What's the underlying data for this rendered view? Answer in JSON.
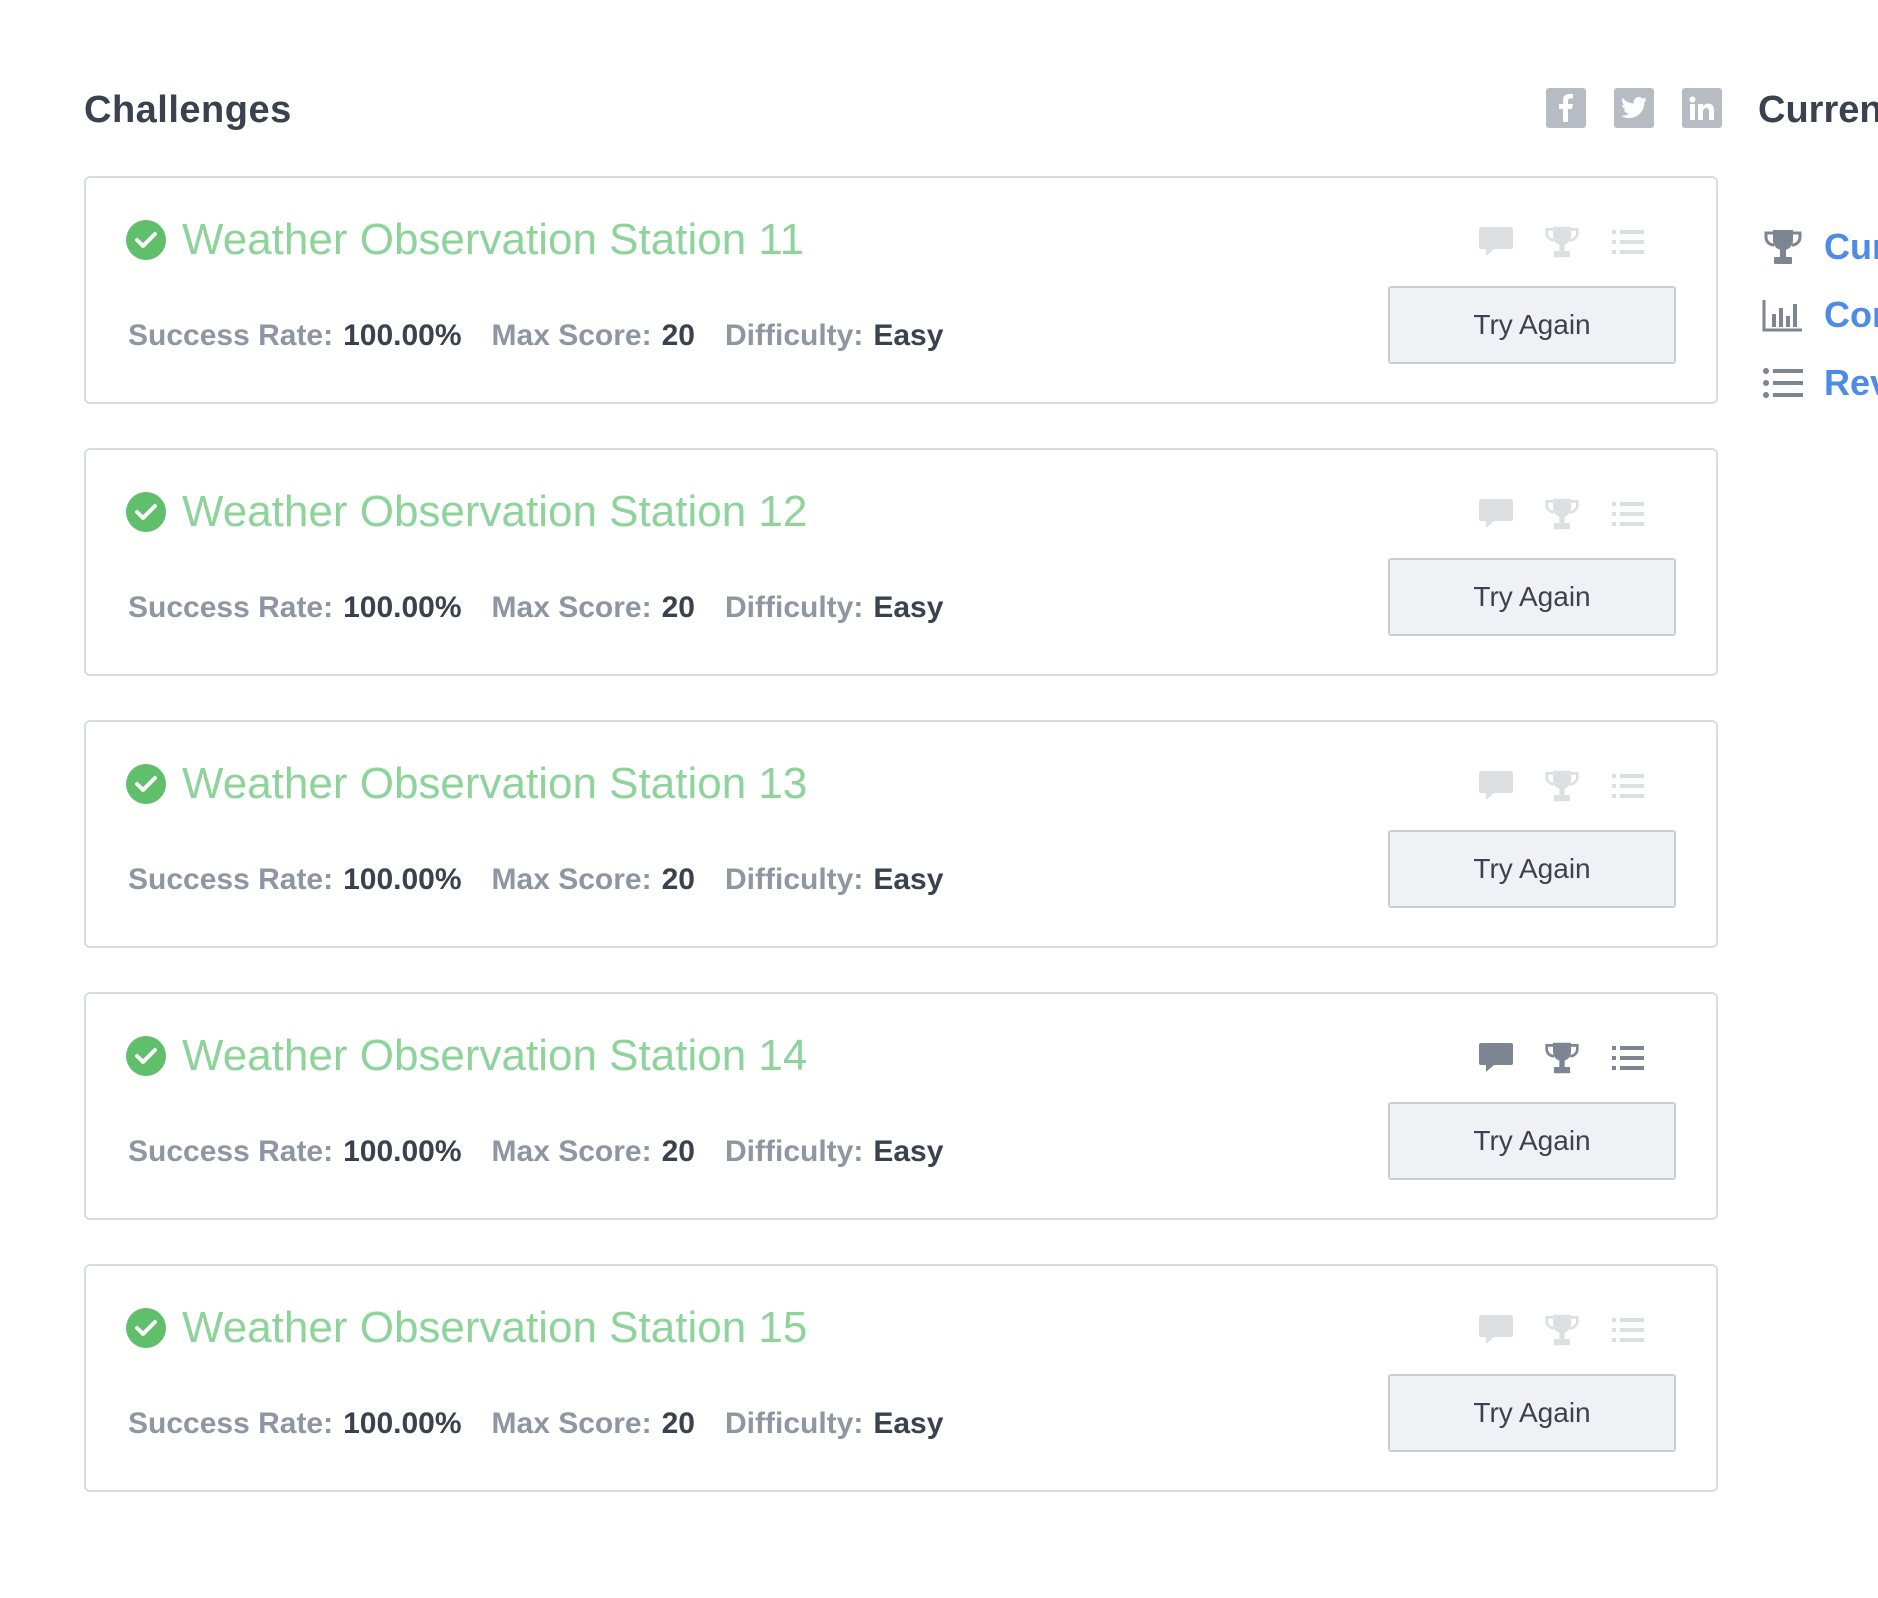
{
  "header": {
    "title": "Challenges",
    "share": [
      {
        "icon": "facebook-icon"
      },
      {
        "icon": "twitter-icon"
      },
      {
        "icon": "linkedin-icon"
      }
    ]
  },
  "challenges": [
    {
      "title": "Weather Observation Station 11",
      "success_rate_label": "Success Rate:",
      "success_rate": "100.00%",
      "max_score_label": "Max Score:",
      "max_score": "20",
      "difficulty_label": "Difficulty:",
      "difficulty": "Easy",
      "button": "Try Again",
      "icons_active": false
    },
    {
      "title": "Weather Observation Station 12",
      "success_rate_label": "Success Rate:",
      "success_rate": "100.00%",
      "max_score_label": "Max Score:",
      "max_score": "20",
      "difficulty_label": "Difficulty:",
      "difficulty": "Easy",
      "button": "Try Again",
      "icons_active": false
    },
    {
      "title": "Weather Observation Station 13",
      "success_rate_label": "Success Rate:",
      "success_rate": "100.00%",
      "max_score_label": "Max Score:",
      "max_score": "20",
      "difficulty_label": "Difficulty:",
      "difficulty": "Easy",
      "button": "Try Again",
      "icons_active": false
    },
    {
      "title": "Weather Observation Station 14",
      "success_rate_label": "Success Rate:",
      "success_rate": "100.00%",
      "max_score_label": "Max Score:",
      "max_score": "20",
      "difficulty_label": "Difficulty:",
      "difficulty": "Easy",
      "button": "Try Again",
      "icons_active": true
    },
    {
      "title": "Weather Observation Station 15",
      "success_rate_label": "Success Rate:",
      "success_rate": "100.00%",
      "max_score_label": "Max Score:",
      "max_score": "20",
      "difficulty_label": "Difficulty:",
      "difficulty": "Easy",
      "button": "Try Again",
      "icons_active": false
    }
  ],
  "sidebar": {
    "title": "Curren",
    "links": [
      {
        "label": "Cur",
        "icon": "trophy-icon"
      },
      {
        "label": "Con",
        "icon": "bar-chart-icon"
      },
      {
        "label": "Rev",
        "icon": "list-icon"
      }
    ]
  },
  "colors": {
    "title_solved": "#8dd39a",
    "check": "#5fbf6b",
    "link": "#4d8be6",
    "text_dark": "#39424e",
    "text_muted": "#8f96a3"
  }
}
